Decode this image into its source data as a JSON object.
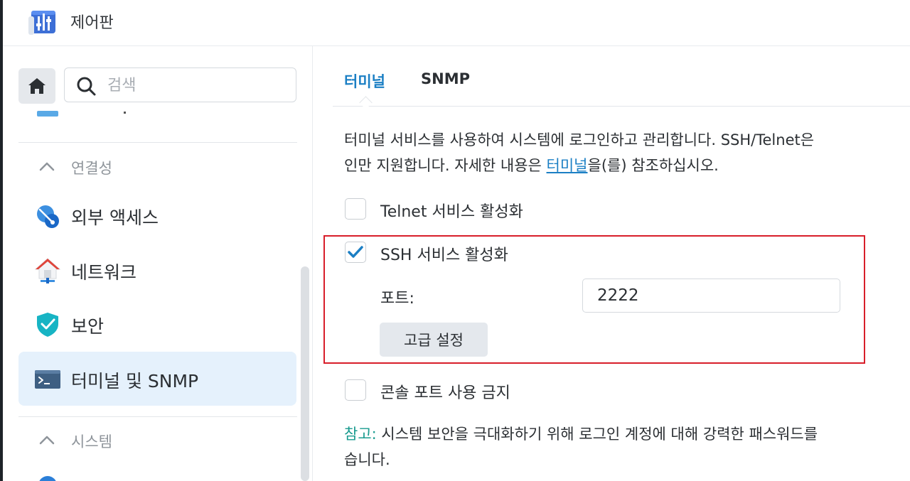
{
  "window": {
    "title": "제어판"
  },
  "sidebar": {
    "search": {
      "placeholder": "검색",
      "value": ""
    },
    "groups": [
      {
        "label": "연결성",
        "items": [
          {
            "label": "외부 액세스",
            "icon": "external-access-icon"
          },
          {
            "label": "네트워크",
            "icon": "network-icon"
          },
          {
            "label": "보안",
            "icon": "security-shield-icon"
          },
          {
            "label": "터미널 및 SNMP",
            "icon": "terminal-icon",
            "active": true
          }
        ]
      },
      {
        "label": "시스템",
        "items": []
      }
    ]
  },
  "main": {
    "tabs": [
      {
        "label": "터미널",
        "active": true
      },
      {
        "label": "SNMP",
        "active": false
      }
    ],
    "description": {
      "line1": "터미널 서비스를 사용하여 시스템에 로그인하고 관리합니다. SSH/Telnet은",
      "line2_before": "인만 지원합니다. 자세한 내용은 ",
      "line2_link": "터미널",
      "line2_after": "을(를) 참조하십시오."
    },
    "telnet": {
      "label": "Telnet 서비스 활성화",
      "checked": false
    },
    "ssh": {
      "label": "SSH 서비스 활성화",
      "checked": true
    },
    "port": {
      "label": "포트:",
      "value": "2222"
    },
    "advanced_button": "고급 설정",
    "console": {
      "label": "콘솔 포트 사용 금지",
      "checked": false
    },
    "note": {
      "prefix": "참고:",
      "line1": " 시스템 보안을 극대화하기 위해 로그인 계정에 대해 강력한 패스워드를",
      "line2": "습니다."
    }
  },
  "colors": {
    "accent": "#1b7fc4",
    "active_item_bg": "#e5f1fc",
    "highlight_border": "#d81e2a",
    "note_prefix": "#1a9b8f"
  }
}
